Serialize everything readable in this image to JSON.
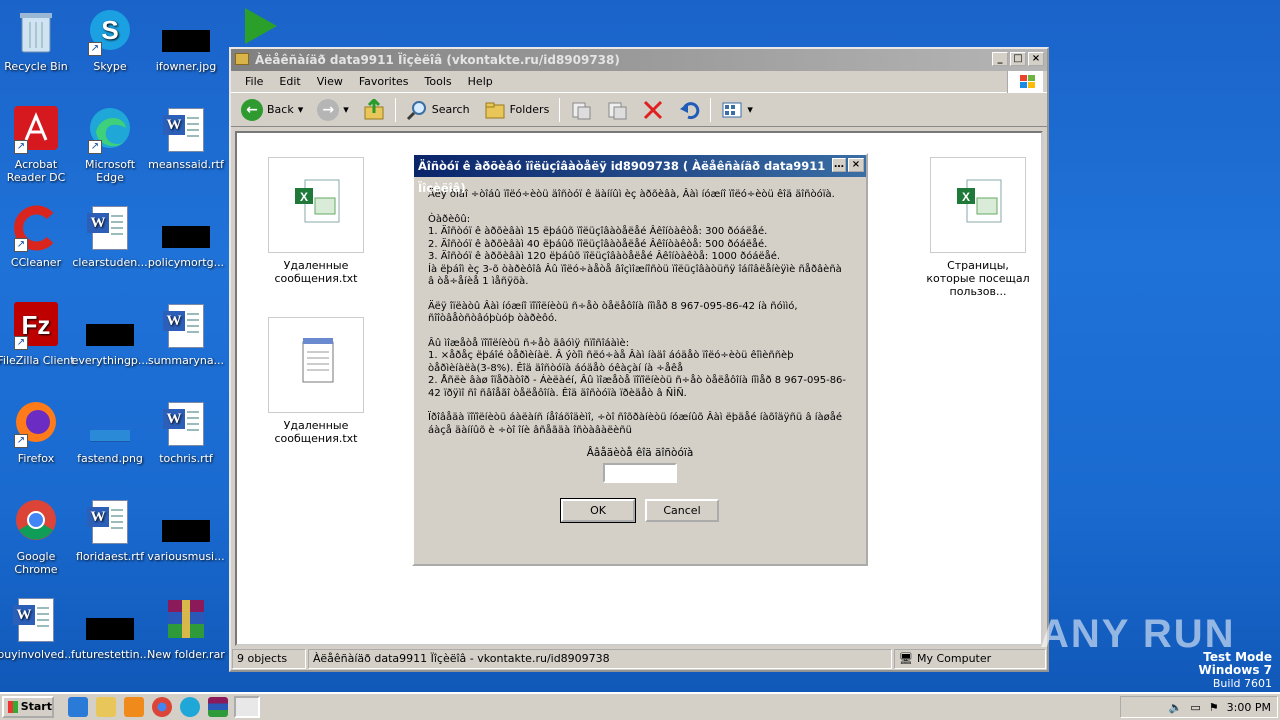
{
  "desktop": {
    "icons": [
      {
        "label": "Recycle Bin"
      },
      {
        "label": "Skype"
      },
      {
        "label": "ifowner.jpg"
      },
      {
        "label": "Acrobat Reader DC"
      },
      {
        "label": "Microsoft Edge"
      },
      {
        "label": "meanssaid.rtf"
      },
      {
        "label": "CCleaner"
      },
      {
        "label": "clearstuden..."
      },
      {
        "label": "policymortg..."
      },
      {
        "label": "FileZilla Client"
      },
      {
        "label": "everythingp..."
      },
      {
        "label": "summaryna..."
      },
      {
        "label": "Firefox"
      },
      {
        "label": "fastend.png"
      },
      {
        "label": "tochris.rtf"
      },
      {
        "label": "Google Chrome"
      },
      {
        "label": "floridaest.rtf"
      },
      {
        "label": "variousmusi..."
      },
      {
        "label": "buyinvolved..."
      },
      {
        "label": "futurestettin..."
      },
      {
        "label": "New folder.rar"
      }
    ]
  },
  "explorer": {
    "title": "Àëåêñàíäð data9911 Ïîçèëîâ (vkontakte.ru/id8909738)",
    "menu": [
      "File",
      "Edit",
      "View",
      "Favorites",
      "Tools",
      "Help"
    ],
    "toolbar": {
      "back": "Back",
      "search": "Search",
      "folders": "Folders"
    },
    "files": [
      {
        "name": "Удаленные сообщения.txt"
      },
      {
        "name": "Удаленные сообщения.txt"
      },
      {
        "name": "Страницы, которые посещал пользов..."
      }
    ],
    "status": {
      "count": "9 objects",
      "path": "Àëåêñàíäð data9911 Ïîçèëîâ - vkontakte.ru/id8909738",
      "zone": "My Computer"
    }
  },
  "dialog": {
    "title": "Äîñòóï ê àðõèâó ïîëüçîâàòåëÿ  id8909738 ( Àëåêñàíäð data9911 Ïîçèëîâ)",
    "paragraphs": [
      "Äëÿ òîãî ÷òîáû ïîëó÷èòü äîñòóï ê äàííûì èç àðõèâà, Âàì íóæíî ïîëó÷èòü êîä äîñòóïà.",
      "Òàðèôû:\n1. Äîñòóï ê àðõèâàì 15 ëþáûõ ïîëüçîâàòåëåé Âêîíòàêòå: 300 ðóáëåé.\n2. Äîñòóï ê àðõèâàì 40 ëþáûõ ïîëüçîâàòåëåé Âêîíòàêòå: 500 ðóáëåé.\n3. Äîñòóï ê àðõèâàì 120 ëþáûõ ïîëüçîâàòåëåé Âêîíòàêòå: 1000 ðóáëåé.\nÍà ëþáîì èç 3-õ òàðèôîâ Âû ïîëó÷àåòå âîçìîæíîñòü ïîëüçîâàòüñÿ îáíîâëåíèÿìè ñåðâèñà â òå÷åíèå 1 ìåñÿöà.",
      "Äëÿ îïëàòû Âàì íóæíî ïîïîëíèòü ñ÷åò òåëåôîíà íîìåð 8 967-095-86-42 íà ñóììó, ñîîòâåòñòâóþùóþ òàðèôó.",
      "Âû ìîæåòå ïîïîëíèòü ñ÷åò äâóìÿ ñïîñîáàìè:\n1. ×åðåç ëþáîé òåðìèíàë. Â ýòîì ñëó÷àå Âàì íàäî áóäåò ïîëó÷èòü êîìèññèþ òåðìèíàëà(3-8%). Êîä äîñòóïà áóäåò óêàçàí íà ÷åêå\n2. Åñëè âàø îïåðàòîð - Áèëàéí, Âû ìîæåòå ïîïîëíèòü ñ÷åò òåëåôîíà íîìåð 8 967-095-86-42 ïðÿìî ñî ñâîåãî òåëåôîíà. Êîä äîñòóïà ïðèäåò â ÑÌÑ.",
      "Ïðîâåäà ïîïîëíèòü áàëàíñ íåîáõîäèìî, ÷òî ñîõðàíèòü íóæíûõ Âàì ëþäåé íàõîäÿñü â íàøåé áàçå äàííûõ è ÷òî îíè âñåãäà îñòàâàëèñü"
    ],
    "prompt": "Ââåäèòå êîä äîñòóïà",
    "ok": "OK",
    "cancel": "Cancel"
  },
  "taskbar": {
    "start": "Start",
    "clock": "3:00 PM"
  },
  "watermark": {
    "line1": "Test Mode",
    "line2": "Windows 7",
    "line3": "Build 7601",
    "brand": "ANY RUN"
  }
}
